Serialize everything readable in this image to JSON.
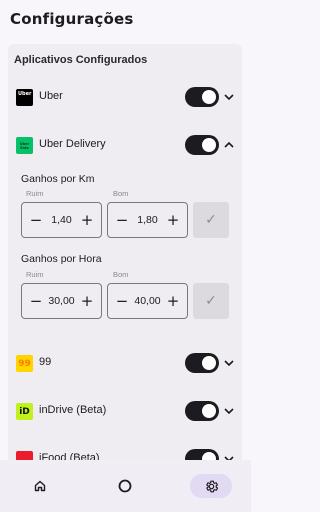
{
  "header": {
    "title": "Configurações"
  },
  "section": {
    "title": "Aplicativos Configurados"
  },
  "apps": [
    {
      "name": "Uber",
      "icon_text": "Uber",
      "icon": "uber-logo",
      "enabled": true,
      "expanded": false
    },
    {
      "name": "Uber Delivery",
      "icon_text": "Uber Eats",
      "icon": "uber-eats-logo",
      "enabled": true,
      "expanded": true
    },
    {
      "name": "99",
      "icon_text": "99",
      "icon": "99-logo",
      "enabled": true,
      "expanded": false
    },
    {
      "name": "inDrive (Beta)",
      "icon_text": "iD",
      "icon": "indrive-logo",
      "enabled": true,
      "expanded": false
    },
    {
      "name": "iFood (Beta)",
      "icon_text": "",
      "icon": "ifood-logo",
      "enabled": true,
      "expanded": false
    }
  ],
  "uber_delivery_settings": {
    "per_km": {
      "title": "Ganhos por Km",
      "bad_label": "Ruim",
      "good_label": "Bom",
      "bad_value": "1,40",
      "good_value": "1,80"
    },
    "per_hour": {
      "title": "Ganhos por Hora",
      "bad_label": "Ruim",
      "good_label": "Bom",
      "bad_value": "30,00",
      "good_value": "40,00"
    },
    "minus_glyph": "−",
    "plus_glyph": "+",
    "confirm_glyph": "✓"
  },
  "bottom_nav": {
    "items": [
      {
        "icon": "home-icon"
      },
      {
        "icon": "circle-icon"
      },
      {
        "icon": "gear-icon",
        "active": true
      }
    ]
  },
  "colors": {
    "background": "#f8f6fb",
    "card": "#f0edf2",
    "toggle_on": "#1c1b1f",
    "nav_active": "#e2d9f2",
    "uber_eats_green": "#06c167",
    "yellow_99": "#ffd500",
    "indrive_green": "#c1f11d",
    "ifood_red": "#ea1d2c"
  }
}
